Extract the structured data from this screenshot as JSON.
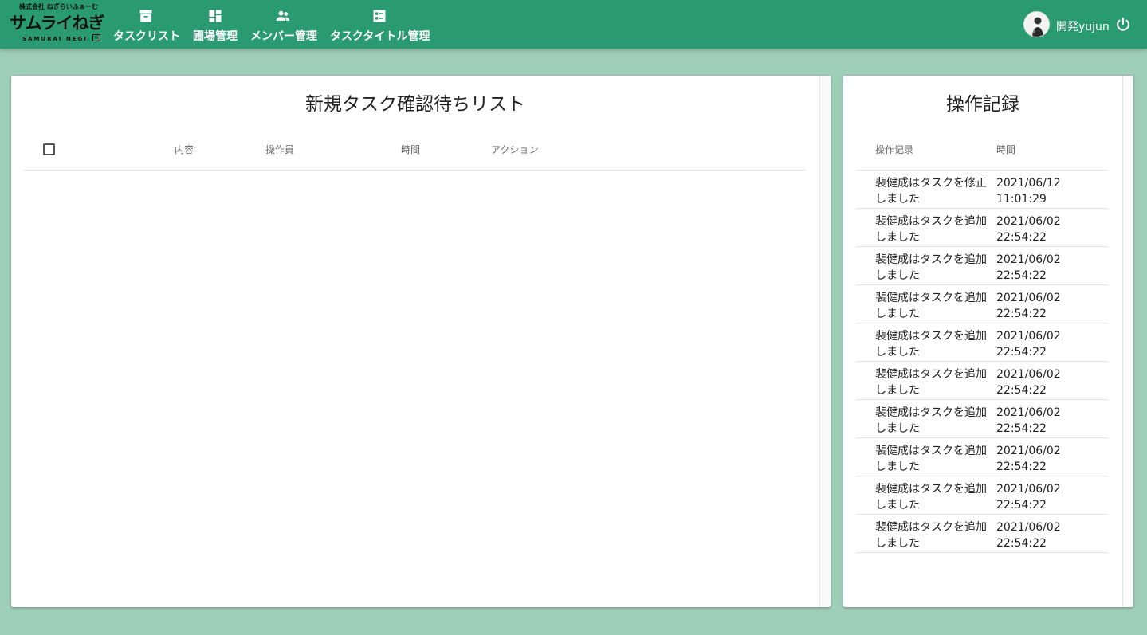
{
  "header": {
    "logo": {
      "company": "株式会社 ねぎらいふぁーむ",
      "name": "サムライねぎ",
      "name_en": "SAMURAI NEGI",
      "badge": "®"
    },
    "nav": [
      {
        "label": "タスクリスト",
        "icon": "archive-box-icon"
      },
      {
        "label": "圃場管理",
        "icon": "dashboard-icon"
      },
      {
        "label": "メンバー管理",
        "icon": "people-icon"
      },
      {
        "label": "タスクタイトル管理",
        "icon": "list-alt-icon"
      }
    ],
    "user": {
      "name": "開発yujun"
    },
    "power_icon": "power-icon"
  },
  "pending_tasks": {
    "title": "新規タスク確認待ちリスト",
    "columns": [
      "内容",
      "操作員",
      "時間",
      "アクション"
    ],
    "rows": []
  },
  "operation_log": {
    "title": "操作記録",
    "columns": [
      "操作记录",
      "時間"
    ],
    "rows": [
      {
        "content": "裴健成はタスクを修正しました",
        "time": "2021/06/12 11:01:29"
      },
      {
        "content": "裴健成はタスクを追加しました",
        "time": "2021/06/02 22:54:22"
      },
      {
        "content": "裴健成はタスクを追加しました",
        "time": "2021/06/02 22:54:22"
      },
      {
        "content": "裴健成はタスクを追加しました",
        "time": "2021/06/02 22:54:22"
      },
      {
        "content": "裴健成はタスクを追加しました",
        "time": "2021/06/02 22:54:22"
      },
      {
        "content": "裴健成はタスクを追加しました",
        "time": "2021/06/02 22:54:22"
      },
      {
        "content": "裴健成はタスクを追加しました",
        "time": "2021/06/02 22:54:22"
      },
      {
        "content": "裴健成はタスクを追加しました",
        "time": "2021/06/02 22:54:22"
      },
      {
        "content": "裴健成はタスクを追加しました",
        "time": "2021/06/02 22:54:22"
      },
      {
        "content": "裴健成はタスクを追加しました",
        "time": "2021/06/02 22:54:22"
      }
    ]
  },
  "colors": {
    "appbar": "#2a9a72",
    "background": "#9ecdb8"
  }
}
